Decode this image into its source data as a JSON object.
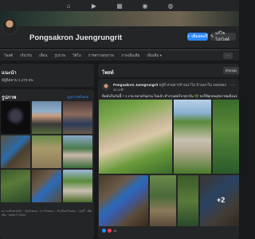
{
  "topnav": {
    "items": [
      {
        "icon": "home-icon",
        "glyph": "⌂"
      },
      {
        "icon": "video-icon",
        "glyph": "▶"
      },
      {
        "icon": "marketplace-icon",
        "glyph": "▦"
      },
      {
        "icon": "groups-icon",
        "glyph": "◉"
      },
      {
        "icon": "gaming-icon",
        "glyph": "◍"
      }
    ]
  },
  "profile": {
    "name": "Pongsakron Juengrungrit",
    "add_story_label": "เพิ่มสตอรี่",
    "edit_profile_label": "แก้ไขโปรไฟล์"
  },
  "tabs": [
    "โพสต์",
    "เกี่ยวกับ",
    "เพื่อน",
    "รูปภาพ",
    "วิดีโอ",
    "การตรวจสุขภาพ",
    "ภาพเพิ่มเติม",
    "เพิ่มเติม ▾"
  ],
  "intro": {
    "title": "แนะนำ",
    "followers": "มีผู้ติดตาม 1,270 คน"
  },
  "photos": {
    "title": "รูปภาพ",
    "see_all": "ดูรูปภาพทั้งหมด"
  },
  "footer": "ความเป็นส่วนตัว · ข้อกำหนด · การโฆษณา · ตัวเลือกโฆษณา · คุกกี้ · เพิ่มเติม · Meta © 2024",
  "posts": {
    "title": "โพสต์",
    "filter_label": "ตัวกรอง",
    "author": "Pongsakron Juengrungrit",
    "author_suffix": " อยู่ที่ สวนยางบ้านนาใน บ้านนาใน จอมทอง",
    "time": "15 นาที ·",
    "text": "ฉีดมันในวันนี้ + 1 งาน หลายวันผ่าน ไปแล้ว ทำงานต่อไป ทุกๆวัน 🌿 ขอให้ทุกคนสุขภาพแข็งแรง ตลอดไป",
    "more_photos": "+2",
    "reaction_count": "10"
  },
  "colors": {
    "background": "#18191a",
    "surface": "#242526",
    "accent": "#2d88ff",
    "text": "#e4e6eb",
    "muted": "#b0b3b8"
  }
}
